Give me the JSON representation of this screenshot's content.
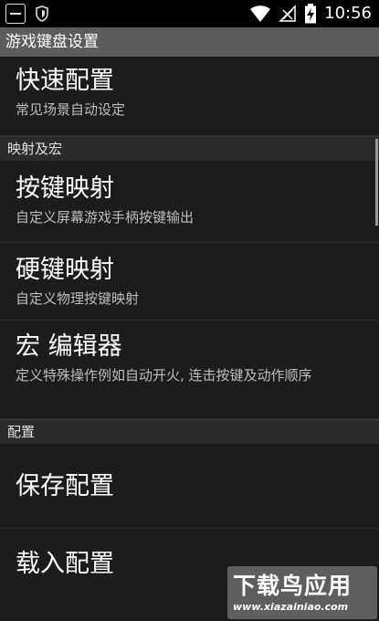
{
  "status_bar": {
    "time": "10:56",
    "icons": [
      "app-notification-icon",
      "shield-icon",
      "wifi-icon",
      "signal-off-icon",
      "battery-charging-icon"
    ]
  },
  "title_bar": {
    "title": "游戏键盘设置"
  },
  "items": [
    {
      "title": "快速配置",
      "subtitle": "常见场景自动设定"
    },
    {
      "header": "映射及宏"
    },
    {
      "title": "按键映射",
      "subtitle": "自定义屏幕游戏手柄按键输出"
    },
    {
      "title": "硬键映射",
      "subtitle": "自定义物理按键映射"
    },
    {
      "title": "宏 编辑器",
      "subtitle": "定义特殊操作例如自动开火, 连击按键及动作顺序"
    },
    {
      "header": "配置"
    },
    {
      "title": "保存配置"
    },
    {
      "title": "载入配置"
    }
  ],
  "watermark": {
    "title": "下载鸟应用",
    "url": "www.xiazainiao.com"
  }
}
